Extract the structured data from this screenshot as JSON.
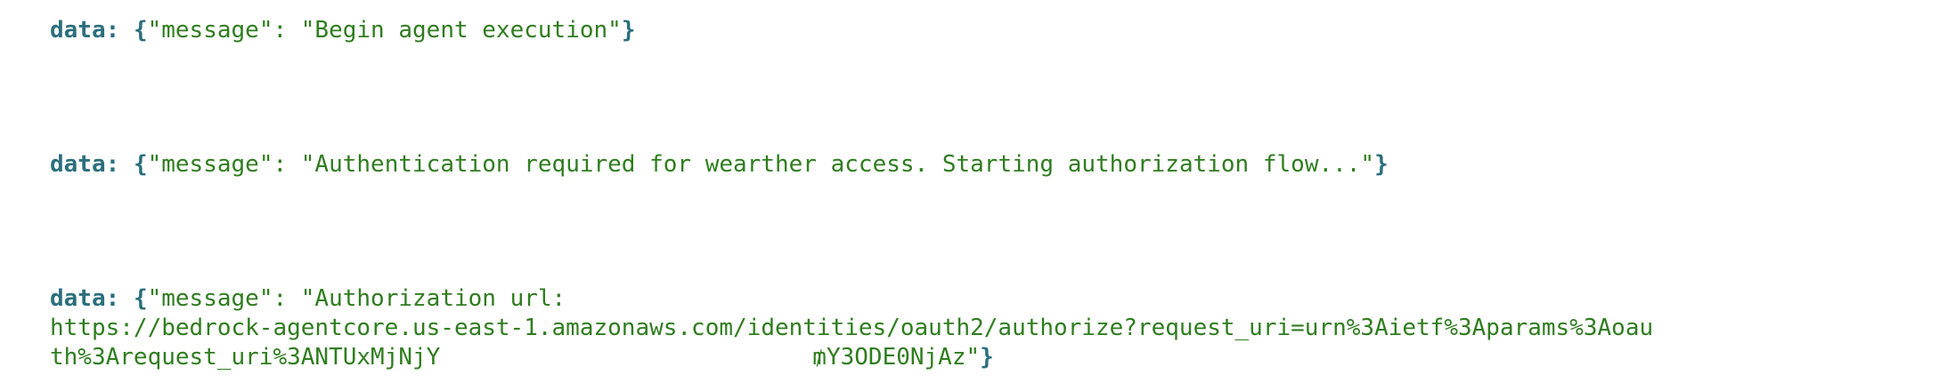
{
  "console": {
    "entries": [
      {
        "prefix": "data:",
        "open_brace": "{",
        "content": "\"message\": \"Begin agent execution\"",
        "close_brace": "}"
      },
      {
        "prefix": "data:",
        "open_brace": "{",
        "content": "\"message\": \"Authentication required for wearther access. Starting authorization flow...\"",
        "close_brace": "}"
      },
      {
        "prefix": "data:",
        "open_brace": "{",
        "content_line1": "\"message\": \"Authorization url:",
        "content_line2": "https://bedrock-agentcore.us-east-1.amazonaws.com/identities/oauth2/authorize?request_uri=urn%3Aietf%3Aparams%3Aoau",
        "content_line3a": "th%3Arequest_uri%3ANTUxMjNjY",
        "content_line3b": "₥Y3ODE0NjAz\"",
        "close_brace": "}"
      }
    ]
  }
}
